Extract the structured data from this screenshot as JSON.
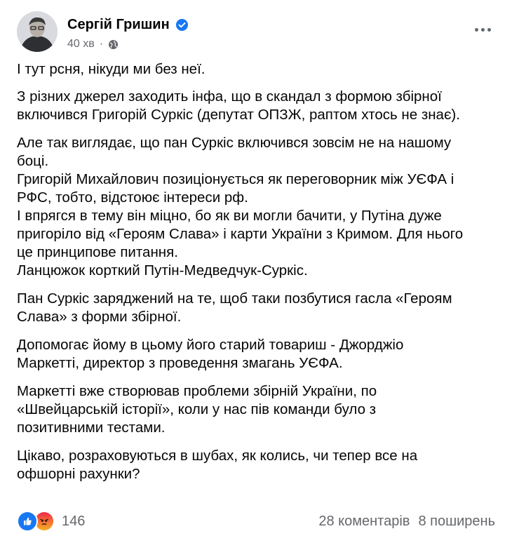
{
  "post": {
    "author": "Сергій Гришин",
    "time": "40 хв",
    "meta_separator": "·",
    "verified_icon": "verified-badge-icon",
    "privacy_icon": "globe-icon",
    "paragraphs": [
      "І тут рсня, нікуди ми без неї.",
      "З різних джерел заходить інфа, що в скандал з формою збірної\nвключився Григорій Суркіс (депутат ОПЗЖ, раптом хтось не знає).",
      "Але так виглядає, що пан Суркіс включився зовсім не на нашому\nбоці.\nГригорій Михайлович позиціонується як переговорник між УЄФА і\nРФС, тобто, відстоює інтереси рф.\nІ впрягся в тему він міцно, бо як ви могли бачити, у Путіна дуже\nпригоріло від «Героям Слава» і карти України з Кримом. Для нього\nце принципове питання.\nЛанцюжок корткий Путін-Медведчук-Суркіс.",
      "Пан Суркіс заряджений на те, щоб таки позбутися гасла «Героям\nСлава» з форми збірної.",
      "Допомогає йому в цьому його старий товариш - Джорджіо\nМаркетті, директор з проведення змагань УЄФА.",
      "Маркетті вже створював проблеми збірній України, по\n«Швейцарській історії», коли у нас пів команди було з\nпозитивними тестами.",
      "Цікаво, розраховуються в шубах, як колись, чи тепер все на\nофшорні рахунки?"
    ],
    "reactions": {
      "types": [
        "like",
        "angry"
      ],
      "count": "146"
    },
    "comments": "28 коментарів",
    "shares": "8 поширень"
  },
  "colors": {
    "like": "#1877f2",
    "verified": "#1877f2",
    "secondary_text": "#65676b"
  }
}
